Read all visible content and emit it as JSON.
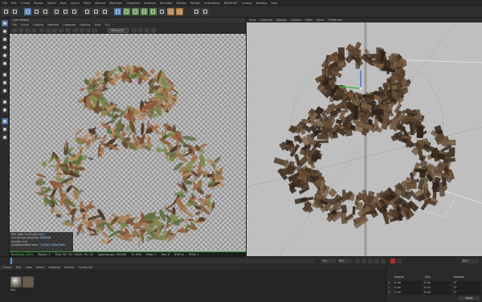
{
  "menubar": {
    "items": [
      "File",
      "Edit",
      "Create",
      "Modes",
      "Select",
      "Tools",
      "Spline",
      "Mesh",
      "Volume",
      "MoGraph",
      "Character",
      "Animate",
      "Simulate",
      "Tracker",
      "Render",
      "Extensions",
      "REDSHIFT",
      "Octane",
      "Window",
      "Help",
      "Layout",
      "Startup"
    ]
  },
  "render_view": {
    "title": "Live Viewer",
    "menu": [
      "File",
      "Cloud",
      "Objects",
      "Material",
      "Compare",
      "Options",
      "Help",
      "Gui"
    ],
    "dropdown": "HDRI/ASD"
  },
  "render_info": {
    "rows": [
      {
        "label": "RTX 3080 Ti (8T)(85)",
        "value": "92%"
      },
      {
        "label": "Out-of-core used/max",
        "value": "0KB/0KB"
      },
      {
        "label": "Used/Fr: 0.0/",
        "value": ""
      },
      {
        "label": "Used/Max/total mem:",
        "value": "7.6Gb/15.8Gb/16Gb"
      }
    ]
  },
  "status": {
    "rendering": "Rendering: 100%",
    "ms": "Ms/sec: 1",
    "time": "Time: 00 : 00 : 00/00 : 00 : 00",
    "spp": "Spp/maxspp: 100/100",
    "tri": "Tri: 0/0k",
    "mesh": "Mesh: 1",
    "hair": "Hair: 0",
    "rtx": "RTX:On",
    "gpus": "GPUs: 1"
  },
  "viewport": {
    "menu": [
      "View",
      "Cameras",
      "Display",
      "Options",
      "Filter",
      "Panel",
      "ProRender"
    ]
  },
  "timeline": {
    "frame": "0 F",
    "end": "90 F",
    "max": "90 F"
  },
  "material_manager": {
    "menu": [
      "Create",
      "Edit",
      "View",
      "Select",
      "Material",
      "Texture",
      "Cycles 4D"
    ],
    "thumb_label": "Mat"
  },
  "coordinates": {
    "headers": [
      "Position",
      "Size",
      "Rotation"
    ],
    "rows": [
      {
        "axis": "X",
        "pos": "0 cm",
        "size": "0 cm",
        "rot": "0°"
      },
      {
        "axis": "Y",
        "pos": "0 cm",
        "size": "0 cm",
        "rot": "0°"
      },
      {
        "axis": "Z",
        "pos": "0 cm",
        "size": "0 cm",
        "rot": "0°"
      }
    ],
    "apply": "Apply"
  },
  "colors": {
    "accent": "#4a7ab0",
    "progress": "#3e9c3e",
    "timeline_head": "#4aa3e0",
    "record": "#b03030"
  }
}
